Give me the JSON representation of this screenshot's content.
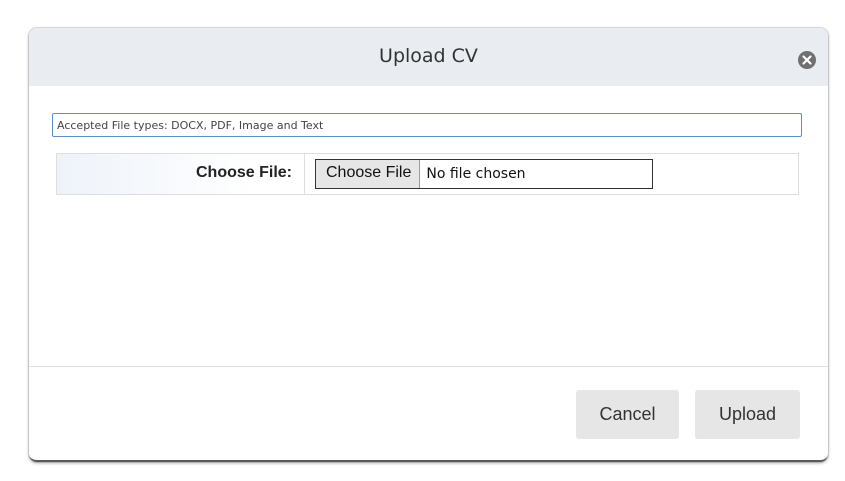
{
  "dialog": {
    "title": "Upload CV",
    "close_icon": "close-circle-icon"
  },
  "form": {
    "accepted_types": "Accepted File types: DOCX, PDF, Image and Text",
    "file_label": "Choose File:",
    "file_button_label": "Choose File",
    "file_status": "No file chosen"
  },
  "footer": {
    "cancel_label": "Cancel",
    "upload_label": "Upload"
  },
  "colors": {
    "header_bg": "#e9edf2",
    "input_focus_border": "#5b8fc7",
    "button_bg": "#e6e6e6"
  }
}
